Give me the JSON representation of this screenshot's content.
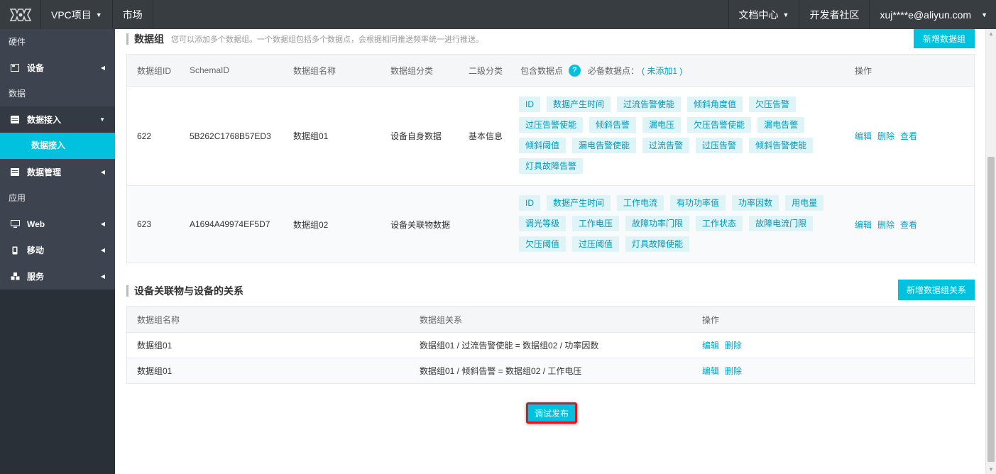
{
  "topbar": {
    "project": "VPC项目",
    "market": "市场",
    "docs": "文档中心",
    "dev_community": "开发者社区",
    "account": "xuj****e@aliyun.com"
  },
  "sidebar": {
    "group_hardware": "硬件",
    "item_device": "设备",
    "group_data": "数据",
    "item_data_access": "数据接入",
    "sub_data_access": "数据接入",
    "item_data_manage": "数据管理",
    "group_app": "应用",
    "item_web": "Web",
    "item_mobile": "移动",
    "item_service": "服务"
  },
  "data_group_section": {
    "title": "数据组",
    "desc": "您可以添加多个数据组。一个数据组包括多个数据点，会根据相同推送频率统一进行推送。",
    "add_button": "新增数据组",
    "headers": {
      "id": "数据组ID",
      "schema": "SchemaID",
      "name": "数据组名称",
      "category": "数据组分类",
      "subcategory": "二级分类",
      "points": "包含数据点",
      "help": "?",
      "required": "必备数据点：",
      "required_link": "( 未添加1 )",
      "ops": "操作"
    },
    "rows": [
      {
        "id": "622",
        "schema": "5B262C1768B57ED3",
        "name": "数据组01",
        "category": "设备自身数据",
        "subcategory": "基本信息",
        "tags": [
          "ID",
          "数据产生时间",
          "过流告警使能",
          "倾斜角度值",
          "欠压告警",
          "过压告警使能",
          "倾斜告警",
          "漏电压",
          "欠压告警使能",
          "漏电告警",
          "倾斜阈值",
          "漏电告警使能",
          "过流告警",
          "过压告警",
          "倾斜告警使能",
          "灯具故障告警"
        ],
        "op_edit": "编辑",
        "op_delete": "删除",
        "op_view": "查看"
      },
      {
        "id": "623",
        "schema": "A1694A49974EF5D7",
        "name": "数据组02",
        "category": "设备关联物数据",
        "subcategory": "",
        "tags": [
          "ID",
          "数据产生时间",
          "工作电流",
          "有功功率值",
          "功率因数",
          "用电量",
          "调光等级",
          "工作电压",
          "故障功率门限",
          "工作状态",
          "故障电流门限",
          "欠压阈值",
          "过压阈值",
          "灯具故障使能"
        ],
        "op_edit": "编辑",
        "op_delete": "删除",
        "op_view": "查看"
      }
    ]
  },
  "relation_section": {
    "title": "设备关联物与设备的关系",
    "add_button": "新增数据组关系",
    "headers": {
      "name": "数据组名称",
      "relation": "数据组关系",
      "ops": "操作"
    },
    "rows": [
      {
        "name": "数据组01",
        "relation": "数据组01 / 过流告警使能 = 数据组02 / 功率因数",
        "op_edit": "编辑",
        "op_delete": "删除"
      },
      {
        "name": "数据组01",
        "relation": "数据组01 / 倾斜告警 = 数据组02 / 工作电压",
        "op_edit": "编辑",
        "op_delete": "删除"
      }
    ]
  },
  "publish_button": "调试发布"
}
